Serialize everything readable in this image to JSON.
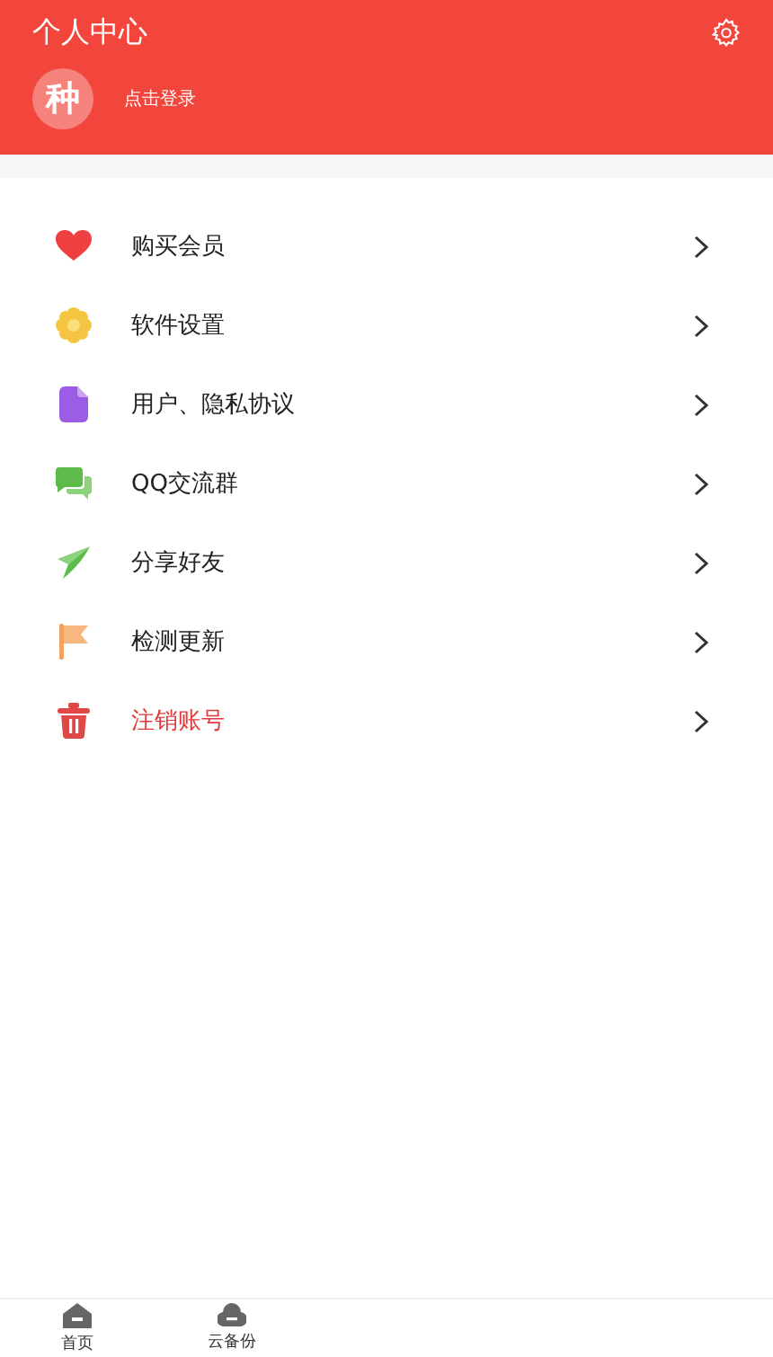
{
  "header": {
    "title": "个人中心",
    "avatar": "种",
    "login": "点击登录"
  },
  "menu": [
    {
      "label": "购买会员",
      "kind": "normal"
    },
    {
      "label": "软件设置",
      "kind": "normal"
    },
    {
      "label": "用户、隐私协议",
      "kind": "normal"
    },
    {
      "label": "QQ交流群",
      "kind": "normal"
    },
    {
      "label": "分享好友",
      "kind": "normal"
    },
    {
      "label": "检测更新",
      "kind": "normal"
    },
    {
      "label": "注销账号",
      "kind": "danger"
    }
  ],
  "tab_bar": [
    {
      "label": "首页"
    },
    {
      "label": "云备份"
    }
  ]
}
